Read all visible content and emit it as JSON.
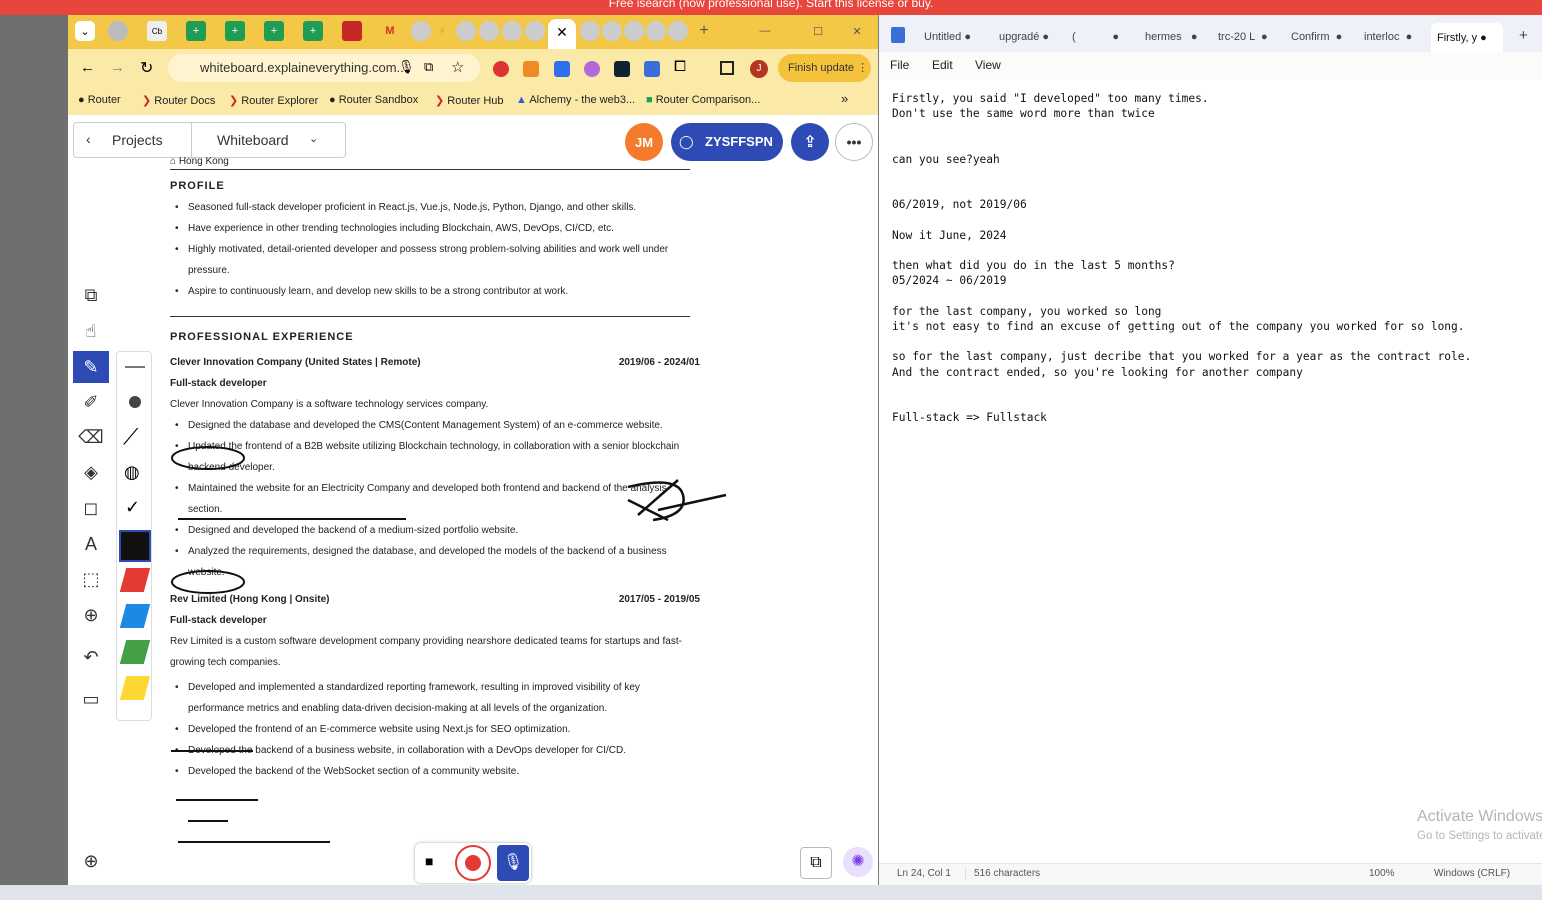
{
  "banner": {
    "text": "Free isearch (now professional use). Start this license or buy."
  },
  "chrome": {
    "url": "whiteboard.explaineverything.com...",
    "finish_update": "Finish update",
    "bookmarks": [
      "Router",
      "Router Docs",
      "Router Explorer",
      "Router Sandbox",
      "Router Hub",
      "Alchemy - the web3...",
      "Router Comparison..."
    ],
    "more": "»"
  },
  "whiteboard": {
    "projects": "Projects",
    "title": "Whiteboard",
    "avatar": "JM",
    "user": "ZYSFFSPN"
  },
  "resume": {
    "location": "Hong Kong",
    "profile_heading": "PROFILE",
    "profile": [
      "Seasoned full-stack developer proficient in React.js, Vue.js, Node.js, Python, Django, and other skills.",
      "Have experience in other trending technologies including Blockchain, AWS, DevOps, CI/CD, etc.",
      "Highly motivated, detail-oriented developer and possess strong problem-solving abilities and work well under pressure.",
      "Aspire to continuously learn, and develop new skills to be a strong contributor at work."
    ],
    "exp_heading": "PROFESSIONAL EXPERIENCE",
    "job1": {
      "company": "Clever Innovation Company (United States | Remote)",
      "dates": "2019/06 - 2024/01",
      "role": "Full-stack developer",
      "desc": "Clever Innovation Company is a software technology services company.",
      "bullets": [
        "Designed the database and developed the CMS(Content Management System) of an e-commerce website.",
        "Updated the frontend of a B2B website utilizing Blockchain technology, in collaboration with a senior blockchain backend developer.",
        "Maintained the website for an Electricity Company and developed both frontend and backend of the analysis section.",
        "Designed and developed the backend of a medium-sized portfolio website.",
        "Analyzed the requirements, designed the database, and developed the models of the backend of a business website."
      ]
    },
    "job2": {
      "company": "Rev Limited  (Hong Kong | Onsite)",
      "dates": "2017/05 - 2019/05",
      "role": "Full-stack developer",
      "desc": "Rev Limited is a custom software development company providing nearshore dedicated teams for startups and fast-growing tech companies.",
      "bullets": [
        "Developed and implemented a standardized reporting framework, resulting in improved visibility of key performance metrics and enabling data-driven decision-making at all levels of the organization.",
        "Developed the frontend of an E-commerce website using Next.js for SEO optimization.",
        "Developed the backend of a business website, in collaboration with a DevOps developer for CI/CD.",
        "Developed the backend of the WebSocket section of a community website."
      ]
    }
  },
  "notepad": {
    "tabs": [
      "Untitled",
      "upgradé",
      "(",
      "hermes",
      "trc-20 L",
      "Confirm",
      "interloc",
      "Firstly, y"
    ],
    "menu": [
      "File",
      "Edit",
      "View"
    ],
    "text": "Firstly, you said \"I developed\" too many times.\nDon't use the same word more than twice\n\n\ncan you see?yeah\n\n\n06/2019, not 2019/06\n\nNow it June, 2024\n\nthen what did you do in the last 5 months?\n05/2024 ~ 06/2019\n\nfor the last company, you worked so long\nit's not easy to find an excuse of getting out of the company you worked for so long.\n\nso for the last company, just decribe that you worked for a year as the contract role.\nAnd the contract ended, so you're looking for another company\n\n\nFull-stack => Fullstack",
    "status_pos": "Ln 24, Col 1",
    "status_chars": "516 characters",
    "zoom": "100%",
    "eol": "Windows (CRLF)",
    "watermark1": "Activate Windows",
    "watermark2": "Go to Settings to activate Windows."
  }
}
